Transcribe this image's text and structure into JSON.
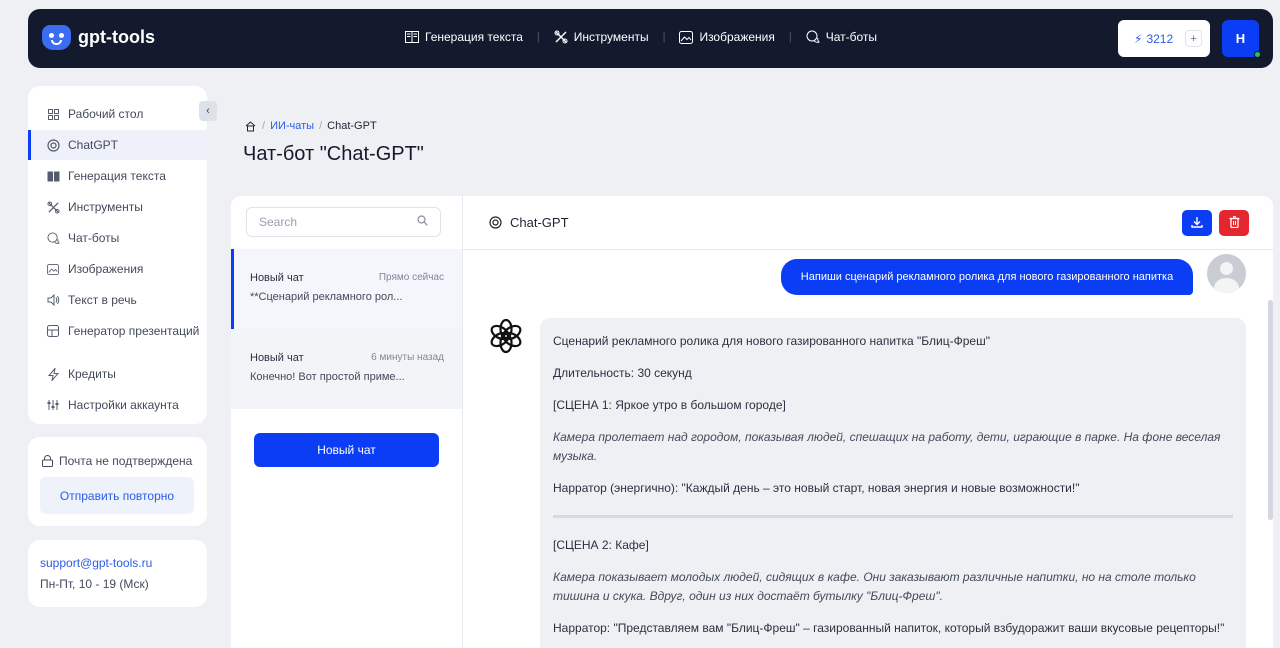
{
  "header": {
    "logo_text": "gpt-tools",
    "nav": [
      {
        "label": "Генерация текста",
        "icon": "book-icon"
      },
      {
        "label": "Инструменты",
        "icon": "tools-icon"
      },
      {
        "label": "Изображения",
        "icon": "image-icon"
      },
      {
        "label": "Чат-боты",
        "icon": "chat-icon"
      }
    ],
    "credits": "3212",
    "credits_plus": "+",
    "user_initial": "Н"
  },
  "sidebar": {
    "items": [
      {
        "label": "Рабочий стол",
        "icon": "dashboard-icon"
      },
      {
        "label": "ChatGPT",
        "icon": "openai-icon"
      },
      {
        "label": "Генерация текста",
        "icon": "book-icon"
      },
      {
        "label": "Инструменты",
        "icon": "tools-icon"
      },
      {
        "label": "Чат-боты",
        "icon": "chat-icon"
      },
      {
        "label": "Изображения",
        "icon": "image-icon"
      },
      {
        "label": "Текст в речь",
        "icon": "speaker-icon"
      },
      {
        "label": "Генератор презентаций",
        "icon": "presentation-icon"
      },
      {
        "label": "Кредиты",
        "icon": "lightning-icon"
      },
      {
        "label": "Настройки аккаунта",
        "icon": "settings-icon"
      }
    ],
    "mail_status": "Почта не подтверждена",
    "resend_label": "Отправить повторно",
    "support_email": "support@gpt-tools.ru",
    "support_hours": "Пн-Пт, 10 - 19 (Мск)"
  },
  "breadcrumb": {
    "home_icon": "home-icon",
    "section": "ИИ-чаты",
    "current": "Chat-GPT"
  },
  "page_title": "Чат-бот \"Chat-GPT\"",
  "chat_list": {
    "search_placeholder": "Search",
    "chats": [
      {
        "title": "Новый чат",
        "time": "Прямо сейчас",
        "snippet": "**Сценарий рекламного рол..."
      },
      {
        "title": "Новый чат",
        "time": "6 минуты назад",
        "snippet": "Конечно! Вот простой приме..."
      }
    ],
    "new_chat_label": "Новый чат"
  },
  "chat": {
    "title": "Chat-GPT",
    "user_message": "Напиши сценарий рекламного ролика для нового газированного напитка",
    "bot": {
      "heading": "Сценарий рекламного ролика для нового газированного напитка \"Блиц-Фреш\"",
      "duration": "Длительность: 30 секунд",
      "scene1_title": "[СЦЕНА 1: Яркое утро в большом городе]",
      "scene1_desc": "Камера пролетает над городом, показывая людей, спешащих на работу, дети, играющие в парке. На фоне веселая музыка.",
      "scene1_narr": "Нарратор (энергично): \"Каждый день – это новый старт, новая энергия и новые возможности!\"",
      "scene2_title": "[СЦЕНА 2: Кафе]",
      "scene2_desc": "Камера показывает молодых людей, сидящих в кафе. Они заказывают различные напитки, но на столе только тишина и скука. Вдруг, один из них достаёт бутылку \"Блиц-Фреш\".",
      "scene2_narr": "Нарратор: \"Представляем вам \"Блиц-Фреш\" – газированный напиток, который взбудоражит ваши вкусовые рецепторы!\""
    }
  },
  "colors": {
    "accent": "#0b3df5",
    "header_bg": "#141a2e",
    "danger": "#e5262e",
    "page_bg": "#eef0f4"
  }
}
